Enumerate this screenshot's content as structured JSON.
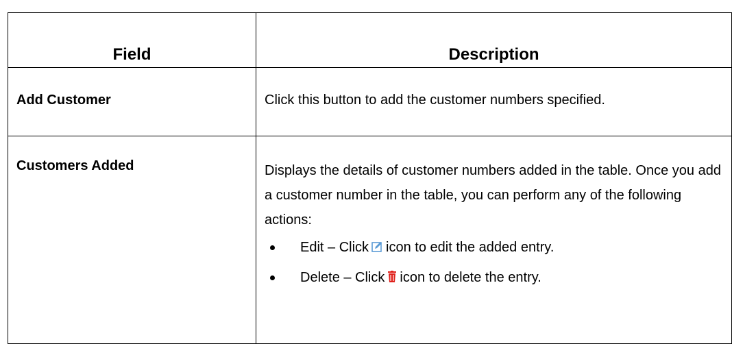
{
  "table": {
    "header": {
      "field": "Field",
      "description": "Description"
    },
    "rows": [
      {
        "field": "Add Customer",
        "description": "Click this button to add the customer numbers specified."
      },
      {
        "field": "Customers Added",
        "description": "Displays the details of customer numbers added in the table. Once you add a customer number in the table, you can perform any of the following actions:",
        "actions": [
          {
            "before": "Edit – Click",
            "icon": "edit-icon",
            "icon_color": "#5b9bd5",
            "after": "icon to edit the added entry."
          },
          {
            "before": "Delete – Click",
            "icon": "delete-icon",
            "icon_color": "#e0201b",
            "after": "icon to delete the entry."
          }
        ]
      }
    ]
  }
}
